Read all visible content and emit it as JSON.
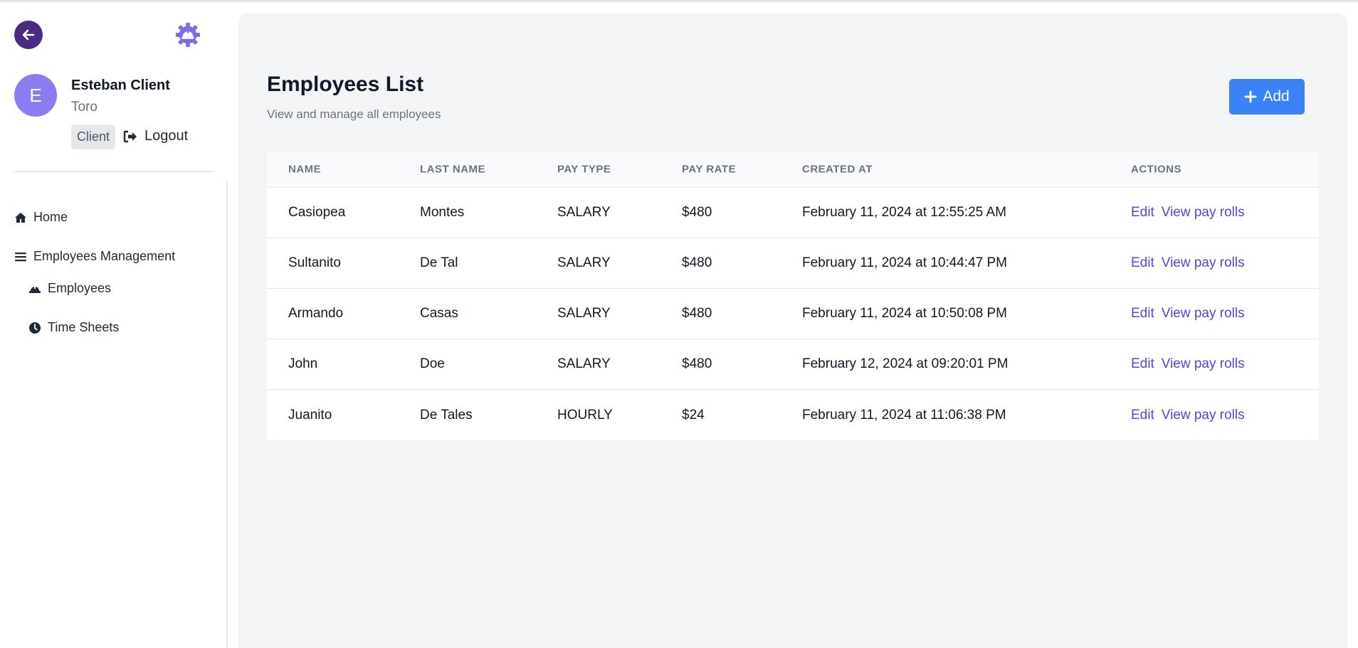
{
  "user": {
    "initial": "E",
    "name": "Esteban Client",
    "company": "Toro",
    "role": "Client",
    "logout_label": "Logout"
  },
  "nav": {
    "home": "Home",
    "management": "Employees Management",
    "employees": "Employees",
    "time_sheets": "Time Sheets"
  },
  "page": {
    "title": "Employees List",
    "subtitle": "View and manage all employees",
    "add_label": "Add"
  },
  "table": {
    "headers": [
      "NAME",
      "LAST NAME",
      "PAY TYPE",
      "PAY RATE",
      "CREATED AT",
      "ACTIONS"
    ],
    "rows": [
      {
        "name": "Casiopea",
        "last_name": "Montes",
        "pay_type": "SALARY",
        "pay_rate": "$480",
        "created_at": "February 11, 2024 at 12:55:25 AM"
      },
      {
        "name": "Sultanito",
        "last_name": "De Tal",
        "pay_type": "SALARY",
        "pay_rate": "$480",
        "created_at": "February 11, 2024 at 10:44:47 PM"
      },
      {
        "name": "Armando",
        "last_name": "Casas",
        "pay_type": "SALARY",
        "pay_rate": "$480",
        "created_at": "February 11, 2024 at 10:50:08 PM"
      },
      {
        "name": "John",
        "last_name": "Doe",
        "pay_type": "SALARY",
        "pay_rate": "$480",
        "created_at": "February 12, 2024 at 09:20:01 PM"
      },
      {
        "name": "Juanito",
        "last_name": "De Tales",
        "pay_type": "HOURLY",
        "pay_rate": "$24",
        "created_at": "February 11, 2024 at 11:06:38 PM"
      }
    ],
    "actions": {
      "edit": "Edit",
      "view": "View pay rolls"
    }
  },
  "colors": {
    "back_button": "#4c2a82",
    "gear": "#7c6cf0",
    "avatar": "#8b7cf0",
    "add_button": "#3b82f6",
    "link": "#4f46e5"
  }
}
